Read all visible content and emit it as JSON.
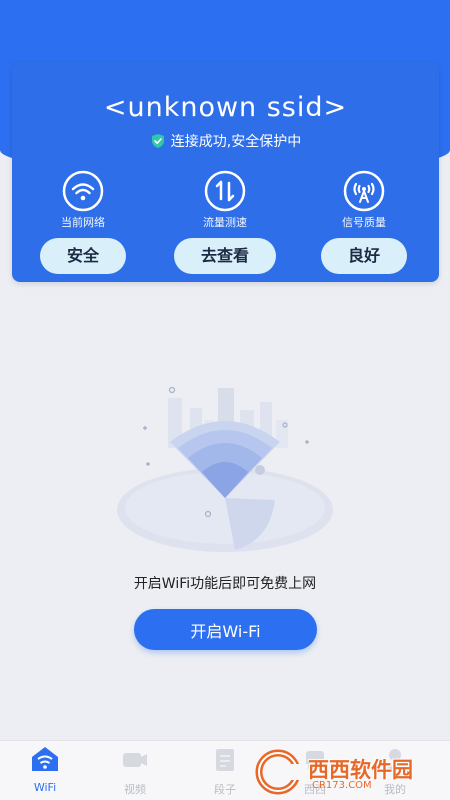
{
  "header": {
    "ssid": "<unknown ssid>",
    "status_text": "连接成功,安全保护中"
  },
  "stats": [
    {
      "icon": "wifi-icon",
      "label": "当前网络",
      "value": "安全"
    },
    {
      "icon": "speed-icon",
      "label": "流量测速",
      "value": "去查看"
    },
    {
      "icon": "signal-tower-icon",
      "label": "信号质量",
      "value": "良好"
    }
  ],
  "main": {
    "prompt": "开启WiFi功能后即可免费上网",
    "open_button_label": "开启Wi-Fi"
  },
  "tabbar": {
    "tabs": [
      {
        "label": "WiFi",
        "active": true
      },
      {
        "label": "视频",
        "active": false
      },
      {
        "label": "段子",
        "active": false
      },
      {
        "label": "西西",
        "active": false
      },
      {
        "label": "我的",
        "active": false
      }
    ]
  },
  "watermark": {
    "main": "西西软件园",
    "sub": "CR173.COM"
  },
  "colors": {
    "primary": "#2c6ff0",
    "pill_bg": "#d9f0fb",
    "page_bg": "#eceef3"
  }
}
